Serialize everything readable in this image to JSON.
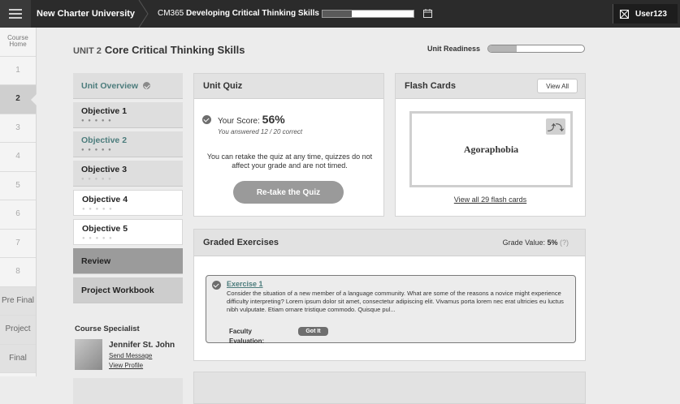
{
  "topbar": {
    "university": "New Charter University",
    "course_code": "CM365",
    "course_name": "Developing Critical Thinking Skills",
    "course_progress": 0.32,
    "user": "User123"
  },
  "leftnav": {
    "items": [
      "Course Home",
      "1",
      "2",
      "3",
      "4",
      "5",
      "6",
      "7",
      "8",
      "Pre Final",
      "Project",
      "Final"
    ],
    "active": "2"
  },
  "unit": {
    "label": "UNIT 2",
    "title": "Core Critical Thinking Skills",
    "readiness_label": "Unit Readiness",
    "readiness_value": 0.3
  },
  "objectives": {
    "overview": "Unit Overview",
    "items": [
      {
        "label": "Objective 1",
        "dots": "● ● ● ● ●"
      },
      {
        "label": "Objective 2",
        "dots": "● ● ● ● ●"
      },
      {
        "label": "Objective 3",
        "dots": "● ● ● ● ●"
      },
      {
        "label": "Objective 4",
        "dots": "● ● ● ● ●"
      },
      {
        "label": "Objective 5",
        "dots": "● ● ● ● ●"
      }
    ],
    "review": "Review",
    "workbook": "Project Workbook"
  },
  "specialist": {
    "title": "Course Specialist",
    "name": "Jennifer St. John",
    "send_message": "Send Message",
    "view_profile": "View Profile"
  },
  "quiz": {
    "title": "Unit Quiz",
    "score_label": "Your Score:",
    "score_value": "56%",
    "answered": "You answered 12 / 20 correct",
    "retake_note": "You can retake the quiz at any time, quizzes do not affect your grade and are not timed.",
    "retake_button": "Re-take the Quiz"
  },
  "flashcards": {
    "title": "Flash Cards",
    "view_all_button": "View All",
    "card_word": "Agoraphobia",
    "view_all_link": "View all 29 flash cards"
  },
  "graded": {
    "title": "Graded Exercises",
    "grade_value_label": "Grade Value:",
    "grade_value": "5%",
    "help": "(?)",
    "exercise_title": "Exercise 1",
    "exercise_text": "Consider the situation of a new member of a language community. What are some of the reasons a novice might experience difficulty interpreting? Lorem ipsum dolor sit amet, consectetur adipiscing elit. Vivamus porta lorem nec erat ultricies eu luctus nibh vulputate. Etiam ornare tristique commodo. Quisque pul...",
    "faculty_label": "Faculty",
    "evaluation_label": "Evaluation:",
    "got_it": "Got It"
  }
}
